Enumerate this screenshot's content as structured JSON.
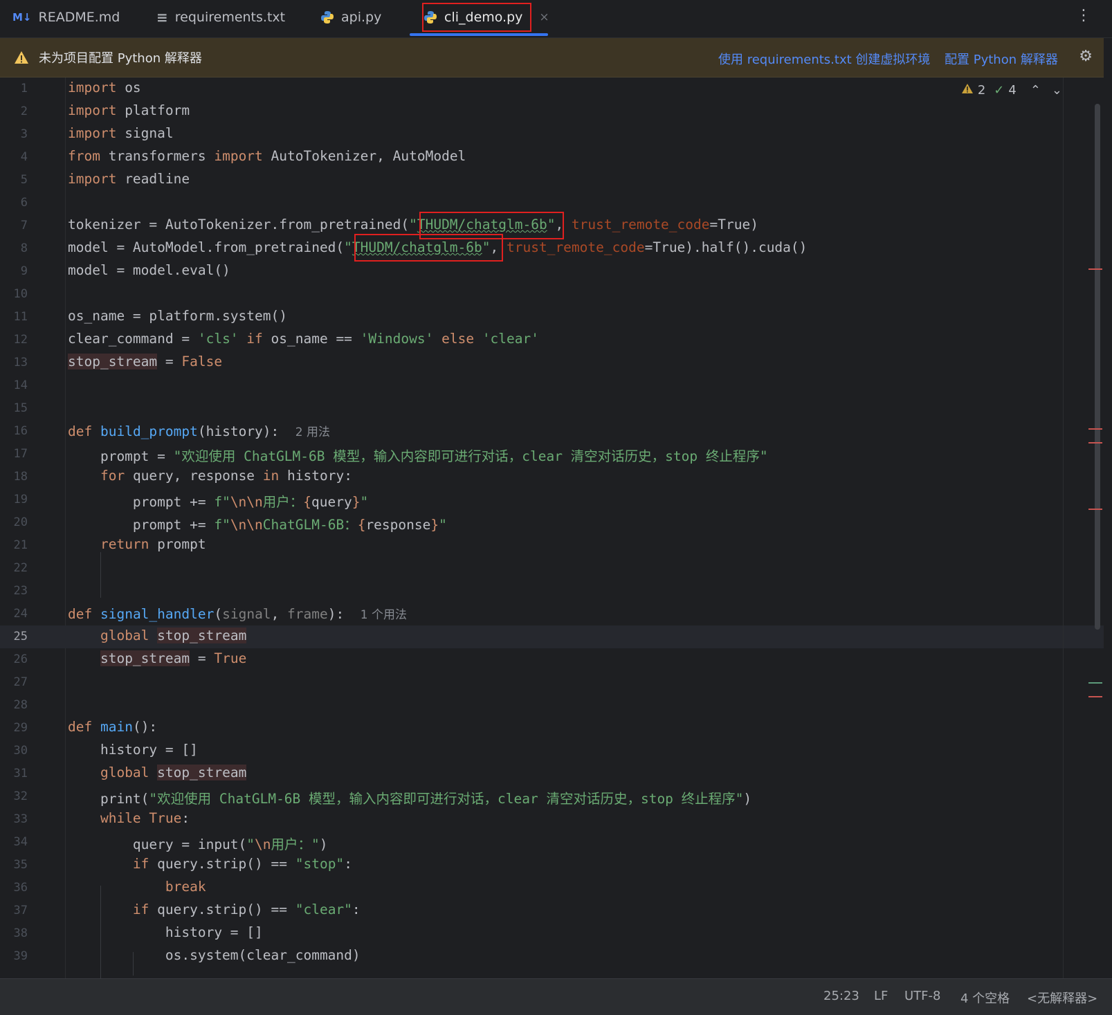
{
  "tabs": [
    {
      "icon": "M↓",
      "label": "README.md"
    },
    {
      "icon": "≡",
      "label": "requirements.txt"
    },
    {
      "icon": "py",
      "label": "api.py"
    },
    {
      "icon": "py",
      "label": "cli_demo.py",
      "close": "×"
    }
  ],
  "banner": {
    "message": "未为项目配置 Python 解释器",
    "link_venv": "使用 requirements.txt 创建虚拟环境",
    "link_configure": "配置 Python 解释器"
  },
  "inspections": {
    "warnings": "2",
    "typos": "4"
  },
  "code_lines": [
    {
      "n": "1"
    },
    {
      "n": "2"
    },
    {
      "n": "3"
    },
    {
      "n": "4"
    },
    {
      "n": "5"
    },
    {
      "n": "6"
    },
    {
      "n": "7"
    },
    {
      "n": "8"
    },
    {
      "n": "9"
    },
    {
      "n": "10"
    },
    {
      "n": "11"
    },
    {
      "n": "12"
    },
    {
      "n": "13"
    },
    {
      "n": "14"
    },
    {
      "n": "15"
    },
    {
      "n": "16"
    },
    {
      "n": "17"
    },
    {
      "n": "18"
    },
    {
      "n": "19"
    },
    {
      "n": "20"
    },
    {
      "n": "21"
    },
    {
      "n": "22"
    },
    {
      "n": "23"
    },
    {
      "n": "24"
    },
    {
      "n": "25"
    },
    {
      "n": "26"
    },
    {
      "n": "27"
    },
    {
      "n": "28"
    },
    {
      "n": "29"
    },
    {
      "n": "30"
    },
    {
      "n": "31"
    },
    {
      "n": "32"
    },
    {
      "n": "33"
    },
    {
      "n": "34"
    },
    {
      "n": "35"
    },
    {
      "n": "36"
    },
    {
      "n": "37"
    },
    {
      "n": "38"
    },
    {
      "n": "39"
    }
  ],
  "code": {
    "l1": [
      "import",
      " os"
    ],
    "l2": [
      "import",
      " platform"
    ],
    "l3": [
      "import",
      " signal"
    ],
    "l4": [
      "from",
      " transformers ",
      "import",
      " AutoTokenizer, AutoModel"
    ],
    "l5": [
      "import",
      " readline"
    ],
    "l7": [
      "tokenizer = AutoTokenizer.from_pretrained(",
      "\"",
      "THUDM/chatglm-6b",
      "\"",
      ", ",
      "trust_remote_code",
      "=True)"
    ],
    "l8": [
      "model = AutoModel.from_pretrained(",
      "\"",
      "THUDM/chatglm-6b",
      "\"",
      ", ",
      "trust_remote_code",
      "=True).half().cuda()"
    ],
    "l9": [
      "model = model.eval()"
    ],
    "l11": [
      "os_name = platform.system()"
    ],
    "l12": [
      "clear_command = ",
      "'cls'",
      " ",
      "if",
      " os_name == ",
      "'Windows'",
      " ",
      "else",
      " ",
      "'clear'"
    ],
    "l13": [
      "stop_stream",
      " = ",
      "False"
    ],
    "l16": [
      "def",
      " ",
      "build_prompt",
      "(history):  ",
      "2 用法"
    ],
    "l17": [
      "    prompt = ",
      "\"欢迎使用 ChatGLM-6B 模型，输入内容即可进行对话，clear 清空对话历史，stop 终止程序\""
    ],
    "l18": [
      "    ",
      "for",
      " query, response ",
      "in",
      " history:"
    ],
    "l19": [
      "        prompt += ",
      "f\"",
      "\\n\\n",
      "用户：",
      "{",
      "query",
      "}",
      "\""
    ],
    "l20": [
      "        prompt += ",
      "f\"",
      "\\n\\n",
      "ChatGLM-6B：",
      "{",
      "response",
      "}",
      "\""
    ],
    "l21": [
      "    ",
      "return",
      " prompt"
    ],
    "l24": [
      "def",
      " ",
      "signal_handler",
      "(",
      "signal",
      ", ",
      "frame",
      "):  ",
      "1 个用法"
    ],
    "l25": [
      "    ",
      "global",
      " ",
      "stop_stream"
    ],
    "l26": [
      "    ",
      "stop_stream",
      " = ",
      "True"
    ],
    "l29": [
      "def",
      " ",
      "main",
      "():"
    ],
    "l30": [
      "    history = []"
    ],
    "l31": [
      "    ",
      "global",
      " ",
      "stop_stream"
    ],
    "l32": [
      "    print(",
      "\"欢迎使用 ChatGLM-6B 模型，输入内容即可进行对话，clear 清空对话历史，stop 终止程序\"",
      ")"
    ],
    "l33": [
      "    ",
      "while",
      " ",
      "True",
      ":"
    ],
    "l34": [
      "        query = input(",
      "\"",
      "\\n",
      "用户：",
      "\"",
      ")"
    ],
    "l35": [
      "        ",
      "if",
      " query.strip() == ",
      "\"stop\"",
      ":"
    ],
    "l36": [
      "            ",
      "break"
    ],
    "l37": [
      "        ",
      "if",
      " query.strip() == ",
      "\"clear\"",
      ":"
    ],
    "l38": [
      "            history = []"
    ],
    "l39": [
      "            os.system(clear_command)"
    ]
  },
  "status": {
    "position": "25:23",
    "line_sep": "LF",
    "encoding": "UTF-8",
    "indent": "4 个空格",
    "interpreter": "<无解释器>"
  },
  "colors": {
    "accent": "#3574f0",
    "highlight_box": "#e0201f",
    "banner_bg": "#3d3524",
    "link": "#548af7"
  }
}
